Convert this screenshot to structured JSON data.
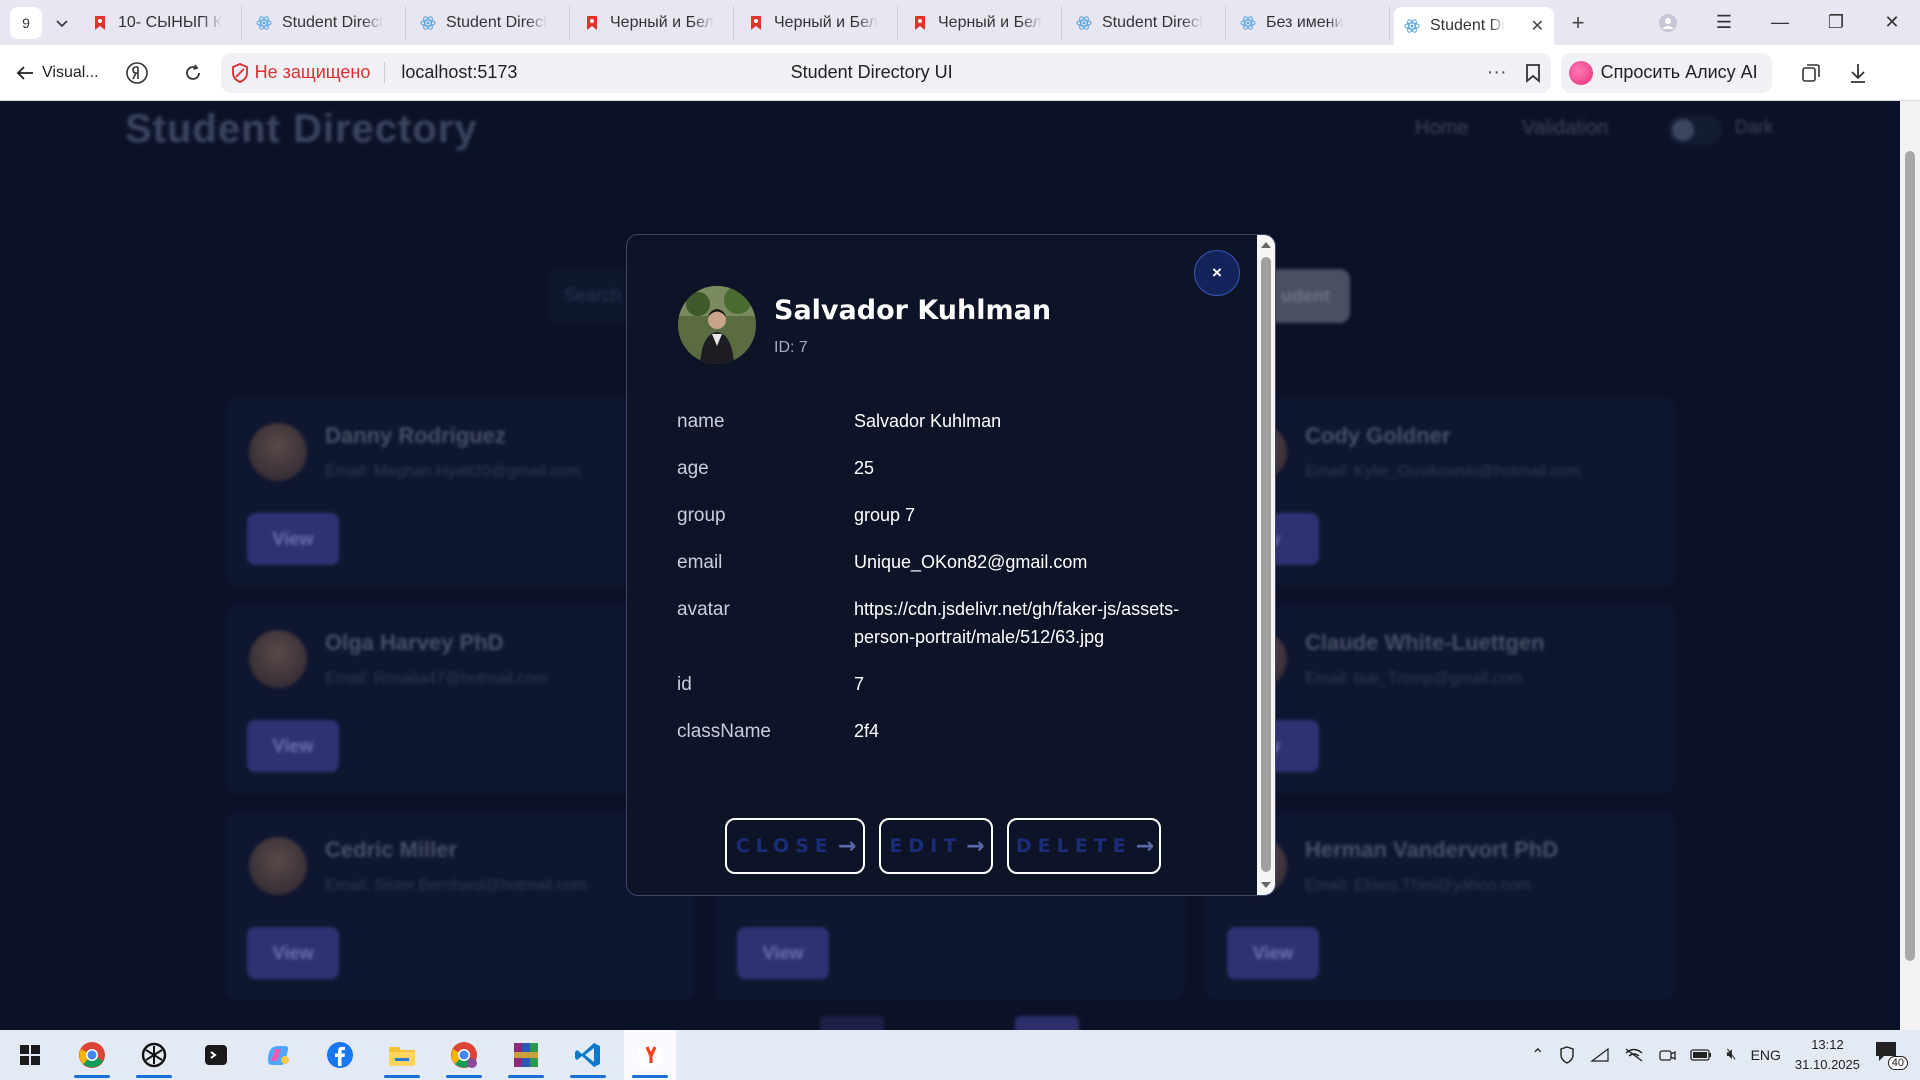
{
  "browser": {
    "tab_count": "9",
    "tabs": [
      {
        "title": "10- СЫНЫП К",
        "favicon": "yandex-bookmark-icon"
      },
      {
        "title": "Student Direct",
        "favicon": "react-icon"
      },
      {
        "title": "Student Direct",
        "favicon": "react-icon"
      },
      {
        "title": "Черный и Бел",
        "favicon": "yandex-bookmark-icon"
      },
      {
        "title": "Черный и Бел",
        "favicon": "yandex-bookmark-icon"
      },
      {
        "title": "Черный и Бел",
        "favicon": "yandex-bookmark-icon"
      },
      {
        "title": "Student Direct",
        "favicon": "react-icon"
      },
      {
        "title": "Без имени",
        "favicon": "react-icon"
      }
    ],
    "active_tab": {
      "title": "Student Di",
      "favicon": "react-icon"
    },
    "back_label": "Visual...",
    "insecure_label": "Не защищено",
    "url": "localhost:5173",
    "page_title": "Student Directory UI",
    "alisa_label": "Спросить Алису AI"
  },
  "app": {
    "title": "Student Directory",
    "nav": {
      "home": "Home",
      "validation": "Validation",
      "dark": "Dark"
    },
    "search_placeholder": "Search",
    "add_button": "udent",
    "cards": [
      {
        "name": "Danny Rodriguez",
        "email": "Email: Meghan.Hyatt20@gmail.com",
        "view": "View"
      },
      {
        "name": "Cody Goldner",
        "email": "Email: Kylie_Gusikowski@hotmail.com",
        "view": "w"
      },
      {
        "name": "Olga Harvey PhD",
        "email": "Email: Rosalia47@hotmail.com",
        "view": "View"
      },
      {
        "name": "Claude White-Luettgen",
        "email": "Email: Isai_Tromp@gmail.com",
        "view": "w"
      },
      {
        "name": "Cedric Miller",
        "email": "Email: Sister.Bernhard@hotmail.com",
        "view": "View"
      },
      {
        "name": "",
        "email": "",
        "view": "View"
      },
      {
        "name": "Herman Vandervort PhD",
        "email": "Email: Eliseo.Thiel@yahoo.com",
        "view": "View"
      }
    ]
  },
  "modal": {
    "close_symbol": "×",
    "name": "Salvador Kuhlman",
    "id_label": "ID: 7",
    "fields": [
      {
        "key": "name",
        "value": "Salvador Kuhlman"
      },
      {
        "key": "age",
        "value": "25"
      },
      {
        "key": "group",
        "value": "group 7"
      },
      {
        "key": "email",
        "value": "Unique_OKon82@gmail.com"
      },
      {
        "key": "avatar",
        "value": "https://cdn.jsdelivr.net/gh/faker-js/assets-person-portrait/male/512/63.jpg"
      },
      {
        "key": "id",
        "value": "7"
      },
      {
        "key": "className",
        "value": "2f4"
      }
    ],
    "buttons": {
      "close": "CLOSE",
      "edit": "EDIT",
      "delete": "DELETE",
      "arrow": "→"
    }
  },
  "taskbar": {
    "lang": "ENG",
    "time": "13:12",
    "date": "31.10.2025",
    "notifications": "40"
  },
  "colors": {
    "page_bg": "#0b1228",
    "modal_bg": "#0e1428",
    "button_text": "#1a2d78",
    "insecure_red": "#d63031"
  }
}
